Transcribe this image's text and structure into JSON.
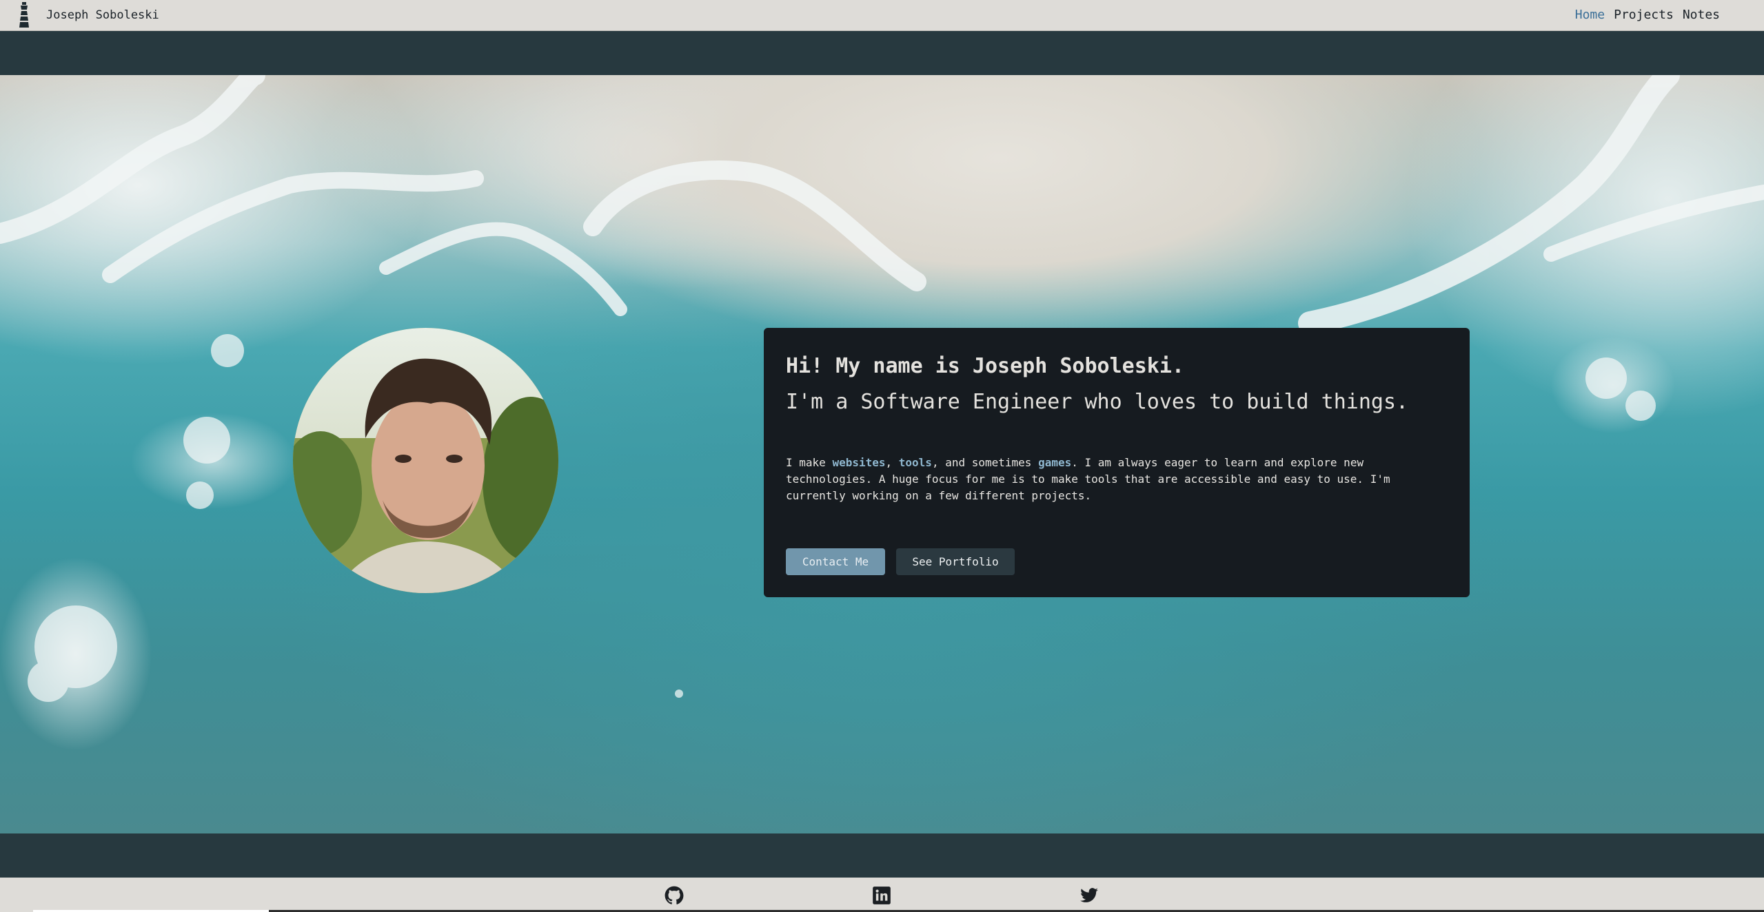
{
  "navbar": {
    "brand_name": "Joseph Soboleski",
    "links": [
      {
        "label": "Home",
        "active": true
      },
      {
        "label": "Projects",
        "active": false
      },
      {
        "label": "Notes",
        "active": false
      }
    ]
  },
  "intro": {
    "heading_line1": "Hi! My name is Joseph Soboleski.",
    "heading_line2": "I'm a Software Engineer who loves to build things.",
    "text_part1": "I make ",
    "link_websites": "websites",
    "text_part2": ", ",
    "link_tools": "tools",
    "text_part3": ", and sometimes ",
    "link_games": "games",
    "text_part4": ". I am always eager to learn and explore new technologies. A huge focus for me is to make tools that are accessible and easy to use. I'm currently working on a few different projects.",
    "contact_button": "Contact Me",
    "portfolio_button": "See Portfolio"
  },
  "footer": {
    "icons": [
      "github-icon",
      "linkedin-icon",
      "twitter-icon"
    ]
  },
  "colors": {
    "nav_active": "#3b6f98",
    "card_bg": "#161b20",
    "band": "#27393f",
    "link_accent": "#8fb7cf",
    "contact_button": "#7196ac"
  }
}
